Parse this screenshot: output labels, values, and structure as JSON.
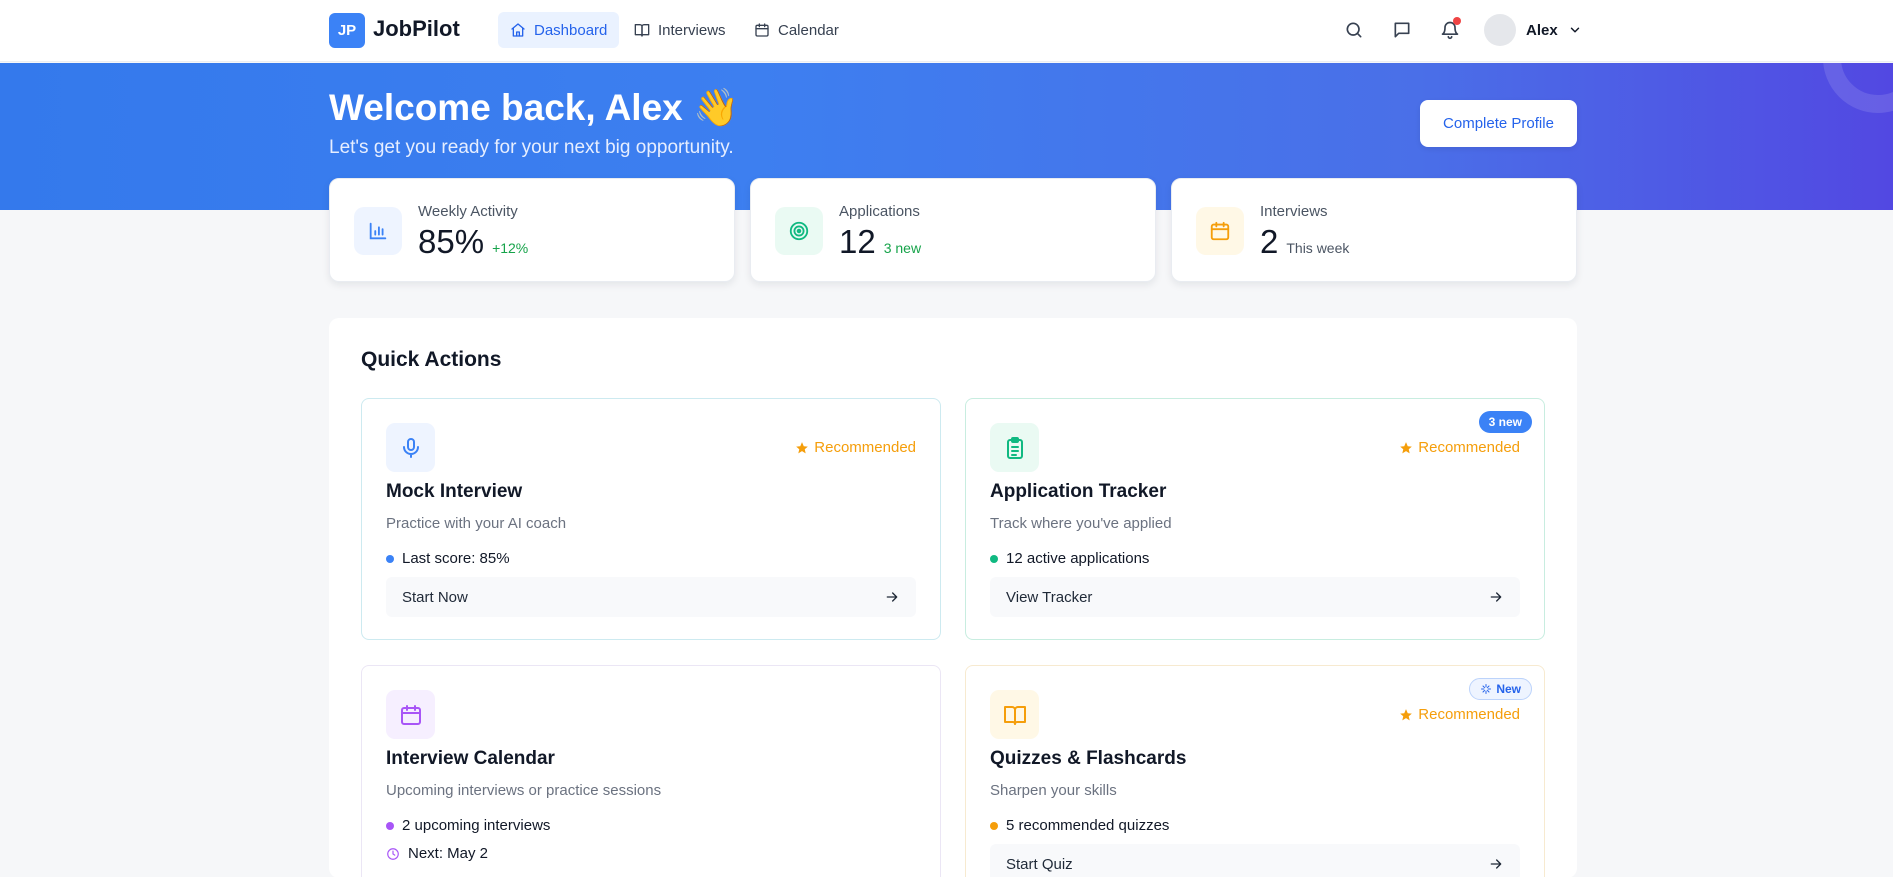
{
  "app": {
    "logo_initials": "JP",
    "name": "JobPilot"
  },
  "nav": {
    "items": [
      {
        "label": "Dashboard",
        "icon": "home-icon",
        "active": true
      },
      {
        "label": "Interviews",
        "icon": "book-icon",
        "active": false
      },
      {
        "label": "Calendar",
        "icon": "calendar-icon",
        "active": false
      }
    ]
  },
  "header_actions": {
    "search_icon": "search-icon",
    "messages_icon": "message-icon",
    "notifications_icon": "bell-icon",
    "user_name": "Alex"
  },
  "hero": {
    "title": "Welcome back, Alex 👋",
    "subtitle": "Let's get you ready for your next big opportunity.",
    "cta": "Complete Profile"
  },
  "stats": [
    {
      "label": "Weekly Activity",
      "value": "85%",
      "note": "+12%",
      "icon": "bar-chart-icon",
      "accent": "#3b82f6",
      "note_color": "#16a34a"
    },
    {
      "label": "Applications",
      "value": "12",
      "note": "3 new",
      "icon": "target-icon",
      "accent": "#10b981",
      "note_color": "#16a34a"
    },
    {
      "label": "Interviews",
      "value": "2",
      "note": "This week",
      "icon": "calendar-icon",
      "accent": "#f59e0b",
      "note_color": "#4b5563"
    }
  ],
  "quick_actions": {
    "title": "Quick Actions",
    "recommended_label": "Recommended",
    "cards": [
      {
        "title": "Mock Interview",
        "desc": "Practice with your AI coach",
        "meta": "Last score: 85%",
        "button": "Start Now",
        "icon": "microphone-icon",
        "accent": "#3b82f6",
        "recommended": true
      },
      {
        "title": "Application Tracker",
        "desc": "Track where you've applied",
        "meta": "12 active applications",
        "button": "View Tracker",
        "icon": "clipboard-icon",
        "accent": "#10b981",
        "recommended": true,
        "badge": "3 new"
      },
      {
        "title": "Interview Calendar",
        "desc": "Upcoming interviews or practice sessions",
        "meta": "2 upcoming interviews",
        "meta2": "Next: May 2",
        "button": "",
        "icon": "calendar-icon",
        "accent": "#a855f7",
        "recommended": false
      },
      {
        "title": "Quizzes & Flashcards",
        "desc": "Sharpen your skills",
        "meta": "5 recommended quizzes",
        "button": "Start Quiz",
        "icon": "open-book-icon",
        "accent": "#f59e0b",
        "recommended": true,
        "badge": "New"
      }
    ]
  }
}
